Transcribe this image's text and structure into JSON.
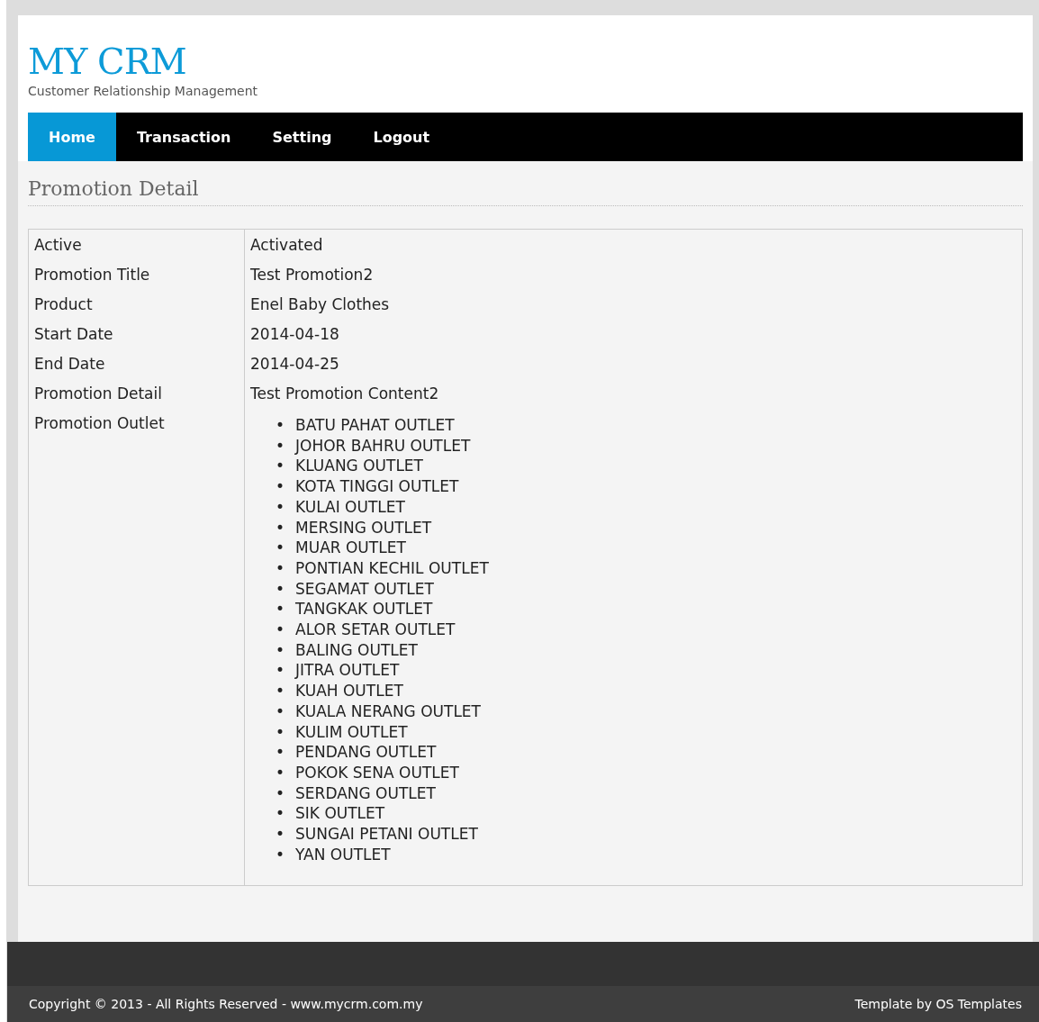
{
  "header": {
    "logo": "MY CRM",
    "tagline": "Customer Relationship Management"
  },
  "nav": [
    {
      "label": "Home",
      "selected": true
    },
    {
      "label": "Transaction",
      "selected": false
    },
    {
      "label": "Setting",
      "selected": false
    },
    {
      "label": "Logout",
      "selected": false
    }
  ],
  "page_title": "Promotion Detail",
  "details": [
    {
      "label": "Active",
      "value": "Activated"
    },
    {
      "label": "Promotion Title",
      "value": "Test Promotion2"
    },
    {
      "label": "Product",
      "value": "Enel Baby Clothes"
    },
    {
      "label": "Start Date",
      "value": "2014-04-18"
    },
    {
      "label": "End Date",
      "value": "2014-04-25"
    },
    {
      "label": "Promotion Detail",
      "value": "Test Promotion Content2"
    },
    {
      "label": "Promotion Outlet",
      "items": [
        {
          "marker": "•",
          "text": "BATU PAHAT OUTLET"
        },
        {
          "marker": "•",
          "text": "JOHOR BAHRU OUTLET"
        },
        {
          "marker": "•",
          "text": "KLUANG OUTLET"
        },
        {
          "marker": "•",
          "text": "KOTA TINGGI OUTLET"
        },
        {
          "marker": "•",
          "text": "KULAI OUTLET"
        },
        {
          "marker": "•",
          "text": "MERSING OUTLET"
        },
        {
          "marker": "•",
          "text": "MUAR OUTLET"
        },
        {
          "marker": "•",
          "text": "PONTIAN KECHIL OUTLET"
        },
        {
          "marker": "•",
          "text": "SEGAMAT OUTLET"
        },
        {
          "marker": "•",
          "text": "TANGKAK OUTLET"
        },
        {
          "marker": "•",
          "text": "ALOR SETAR OUTLET"
        },
        {
          "marker": "•",
          "text": "BALING OUTLET"
        },
        {
          "marker": "•",
          "text": "JITRA OUTLET"
        },
        {
          "marker": "•",
          "text": "KUAH OUTLET"
        },
        {
          "marker": "•",
          "text": "KUALA NERANG OUTLET"
        },
        {
          "marker": "•",
          "text": "KULIM OUTLET"
        },
        {
          "marker": "•",
          "text": "PENDANG OUTLET"
        },
        {
          "marker": "•",
          "text": "POKOK SENA OUTLET"
        },
        {
          "marker": "•",
          "text": "SERDANG OUTLET"
        },
        {
          "marker": "•",
          "text": "SIK OUTLET"
        },
        {
          "marker": "•",
          "text": "SUNGAI PETANI OUTLET"
        },
        {
          "marker": "•",
          "text": "YAN OUTLET"
        }
      ]
    }
  ],
  "footer": {
    "copyright": "Copyright © 2013 - All Rights Reserved - www.mycrm.com.my",
    "credit": "Template by OS Templates"
  }
}
